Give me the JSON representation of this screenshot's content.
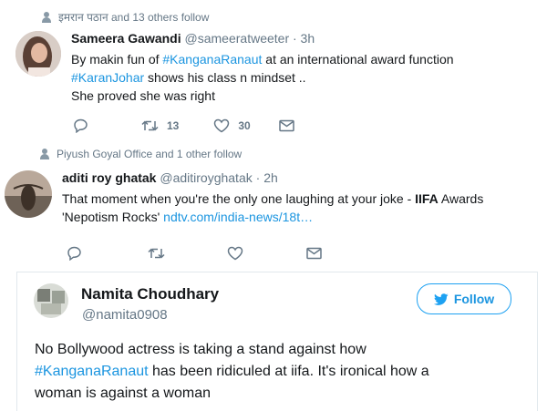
{
  "tweet1": {
    "social_context": "इमरान पठान and 13 others follow",
    "name": "Sameera Gawandi",
    "handle": "@sameeratweeter",
    "time": "· 3h",
    "line1_pre": "By makin fun of ",
    "line1_tag": "#KanganaRanaut",
    "line1_post": "  at an international award function",
    "line2_tag": "#KaranJohar",
    "line2_post": " shows his class n mindset ..",
    "line3": "She proved she was right",
    "retweets": "13",
    "likes": "30"
  },
  "tweet2": {
    "social_context": "Piyush Goyal Office and 1 other follow",
    "name": "aditi roy ghatak",
    "handle": "@aditiroyghatak",
    "time": "· 2h",
    "line1_pre": "That moment when you're the only one laughing at your joke - ",
    "line1_bold": "IIFA",
    "line1_post": " Awards",
    "line2_pre": "'Nepotism Rocks' ",
    "line2_link": "ndtv.com/india-news/18t…"
  },
  "tweet3": {
    "name": "Namita Choudhary",
    "handle": "@namita0908",
    "follow_label": "Follow",
    "line1": "No Bollywood actress is taking a stand against how",
    "line2_tag": "#KanganaRanaut",
    "line2_post": " has been ridiculed at iifa. It's ironical how a",
    "line3": "woman is against a woman"
  },
  "colors": {
    "accent": "#1b95e0",
    "muted": "#657786",
    "border": "#e1e8ed"
  }
}
